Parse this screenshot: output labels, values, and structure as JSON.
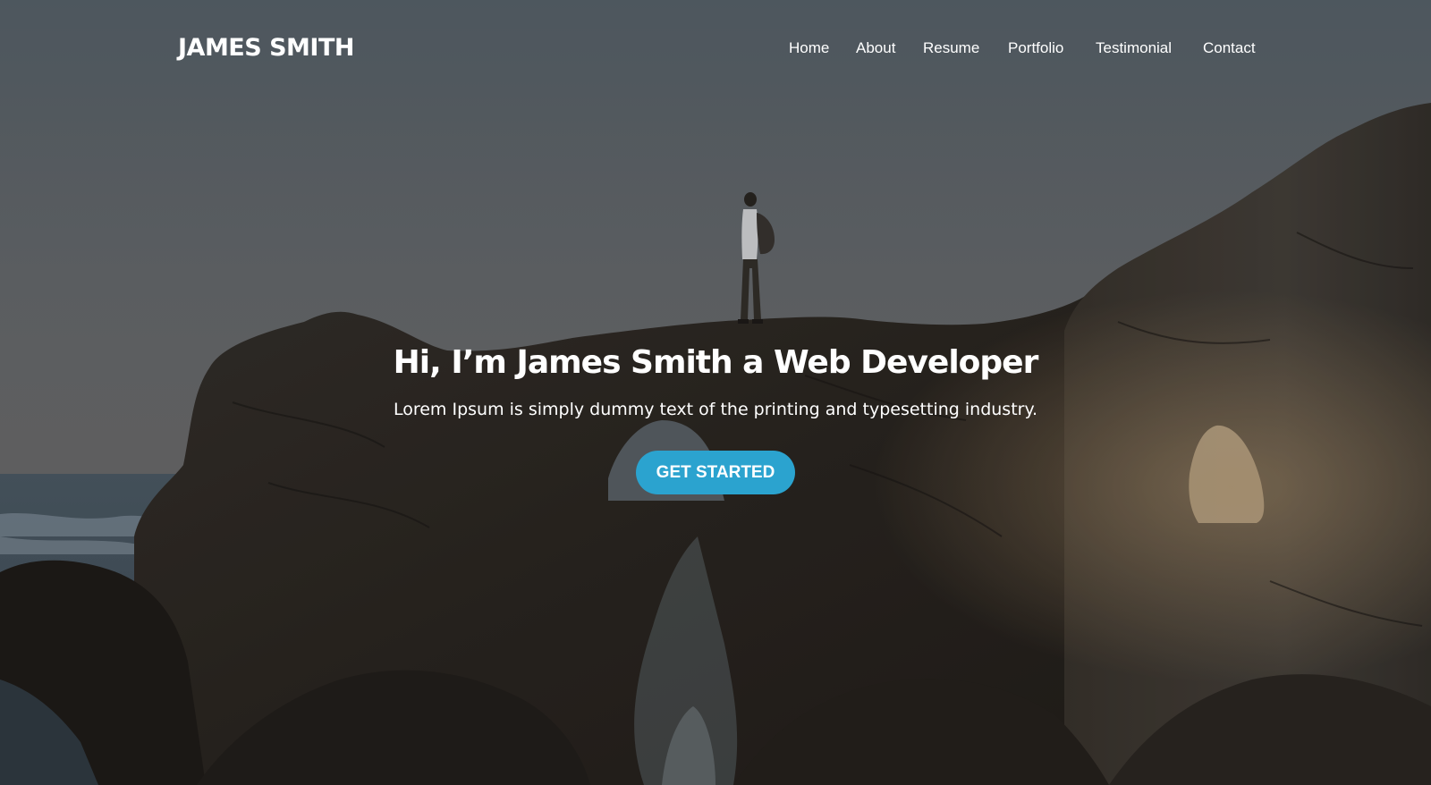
{
  "header": {
    "brand": "JAMES SMITH",
    "nav": [
      {
        "label": "Home"
      },
      {
        "label": "About"
      },
      {
        "label": "Resume"
      },
      {
        "label": "Portfolio"
      },
      {
        "label": "Testimonial"
      },
      {
        "label": "Contact"
      }
    ]
  },
  "hero": {
    "headline": "Hi, I’m James Smith a Web Developer",
    "subline": "Lorem Ipsum is simply dummy text of the printing and typesetting industry.",
    "cta_label": "GET STARTED"
  },
  "colors": {
    "accent": "#2ba3cf",
    "text": "#ffffff",
    "overlay_sky": "#5f666c",
    "rock": "#2e2924"
  }
}
